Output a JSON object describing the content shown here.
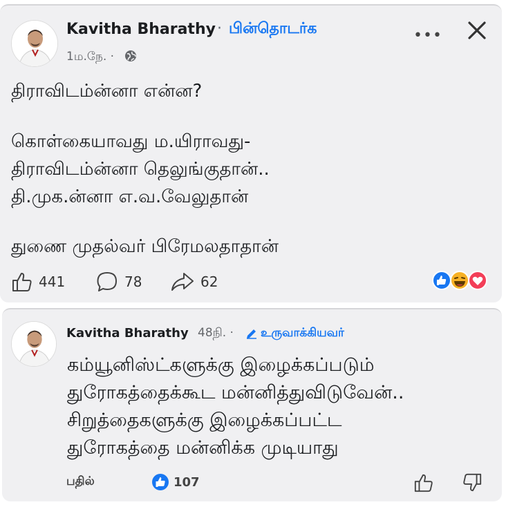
{
  "post": {
    "author": "Kavitha Bharathy",
    "separator": "·",
    "follow_label": "பின்தொடர்க",
    "time": "1ம.நே. ·",
    "lines": [
      "திராவிடம்ன்னா என்ன?",
      "கொள்கையாவது ம.யிராவது-",
      "திராவிடம்ன்னா தெலுங்குதான்..",
      "தி.முக.ன்னா எ.வ.வேலுதான்",
      "துணை முதல்வர் பிரேமலதாதான்"
    ],
    "stats": {
      "likes": "441",
      "comments": "78",
      "shares": "62"
    }
  },
  "comment": {
    "author": "Kavitha Bharathy",
    "time": "48நி. ·",
    "author_badge": "உருவாக்கியவர்",
    "lines": [
      "கம்யூனிஸ்ட்களுக்கு இழைக்கப்படும்",
      "துரோகத்தைக்கூட மன்னித்துவிடுவேன்..",
      "சிறுத்தைகளுக்கு இழைக்கப்பட்ட",
      "துரோகத்தை மன்னிக்க முடியாது"
    ],
    "reply_label": "பதில்",
    "like_count": "107"
  },
  "icons": {
    "more": "more-icon",
    "close": "close-icon",
    "globe": "globe-icon",
    "like": "thumbs-up-icon",
    "comment": "comment-bubble-icon",
    "share": "share-arrow-icon",
    "dislike": "thumbs-down-icon",
    "pencil": "pencil-icon"
  },
  "colors": {
    "accent": "#1877f2",
    "card_bg": "#f0f0f2",
    "love": "#f33e58",
    "haha": "#f7b125"
  }
}
